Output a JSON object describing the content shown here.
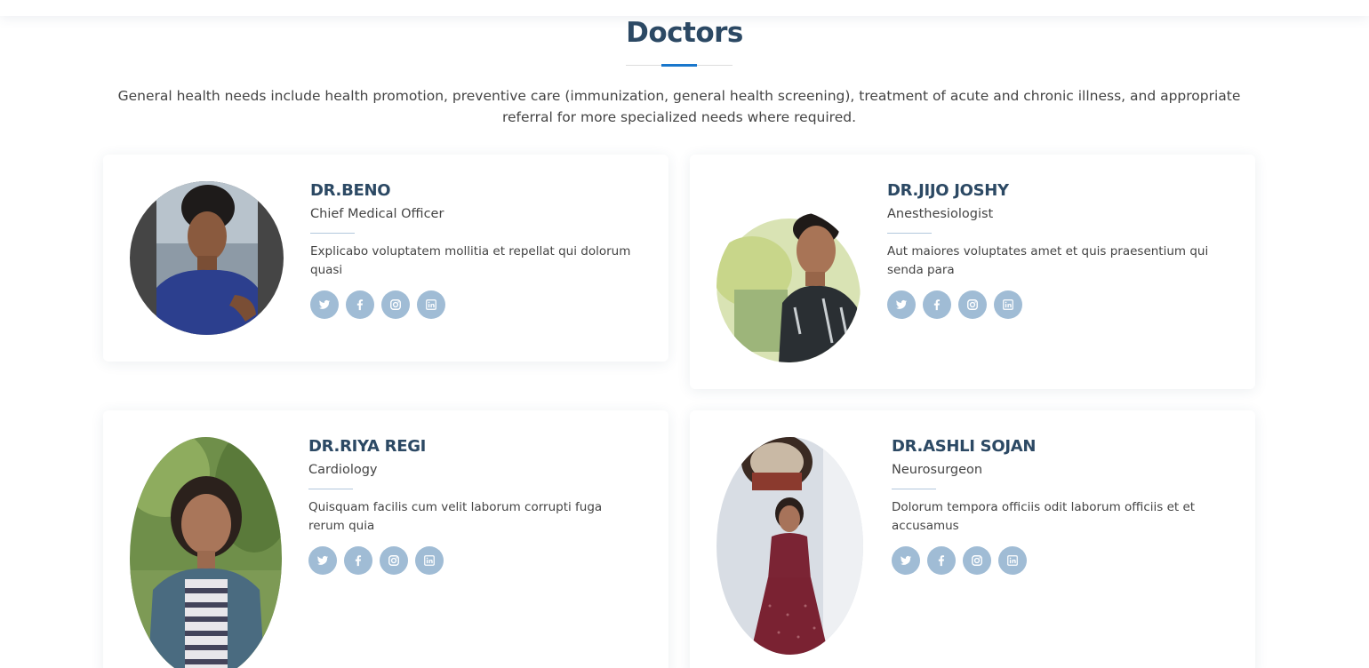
{
  "section": {
    "title": "Doctors",
    "intro": "General health needs include health promotion, preventive care (immunization, general health screening), treatment of acute and chronic illness, and appropriate referral for more specialized needs where required."
  },
  "doctors": [
    {
      "name": "DR.BENO",
      "role": "Chief Medical Officer",
      "description": "Explicabo voluptatem mollitia et repellat qui dolorum quasi",
      "social": [
        "twitter-icon",
        "facebook-icon",
        "instagram-icon",
        "linkedin-icon"
      ]
    },
    {
      "name": "DR.JIJO JOSHY",
      "role": "Anesthesiologist",
      "description": "Aut maiores voluptates amet et quis praesentium qui senda para",
      "social": [
        "twitter-icon",
        "facebook-icon",
        "instagram-icon",
        "linkedin-icon"
      ]
    },
    {
      "name": "DR.RIYA REGI",
      "role": "Cardiology",
      "description": "Quisquam facilis cum velit laborum corrupti fuga rerum quia",
      "social": [
        "twitter-icon",
        "facebook-icon",
        "instagram-icon",
        "linkedin-icon"
      ]
    },
    {
      "name": "DR.ASHLI SOJAN",
      "role": "Neurosurgeon",
      "description": "Dolorum tempora officiis odit laborum officiis et et accusamus",
      "social": [
        "twitter-icon",
        "facebook-icon",
        "instagram-icon",
        "linkedin-icon"
      ]
    }
  ],
  "colors": {
    "heading": "#2c4964",
    "accent": "#1977cc",
    "social_bg": "#a0bcd5",
    "text": "#444444"
  }
}
